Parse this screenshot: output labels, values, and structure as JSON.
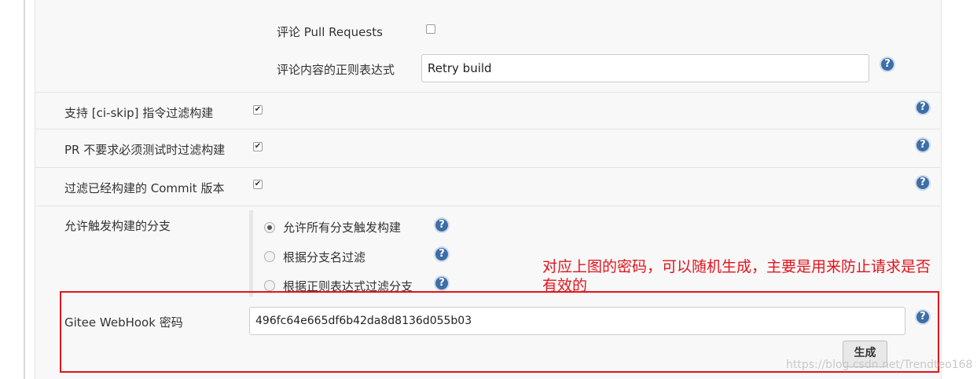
{
  "form": {
    "comment_pr": {
      "label": "评论 Pull Requests",
      "checked": false
    },
    "comment_regex": {
      "label": "评论内容的正则表达式",
      "value": "Retry build"
    },
    "ci_skip": {
      "label": "支持 [ci-skip] 指令过滤构建",
      "checked": true
    },
    "pr_no_test": {
      "label": "PR 不要求必须测试时过滤构建",
      "checked": true
    },
    "filter_built": {
      "label": "过滤已经构建的 Commit 版本",
      "checked": true
    },
    "branches": {
      "label": "允许触发构建的分支",
      "options": [
        {
          "label": "允许所有分支触发构建",
          "selected": true
        },
        {
          "label": "根据分支名过滤",
          "selected": false
        },
        {
          "label": "根据正则表达式过滤分支",
          "selected": false
        }
      ]
    },
    "webhook": {
      "label": "Gitee WebHook 密码",
      "value": "496fc64e665df6b42da8d8136d055b03",
      "generate_label": "生成"
    }
  },
  "help_icon_glyph": "?",
  "annotation": {
    "line1": "对应上图的密码，可以随机生成，主要是用来防止请求是否",
    "line2": "有效的",
    "color": "#e1141c"
  },
  "watermark": "https://blog.csdn.net/Trendteo168"
}
